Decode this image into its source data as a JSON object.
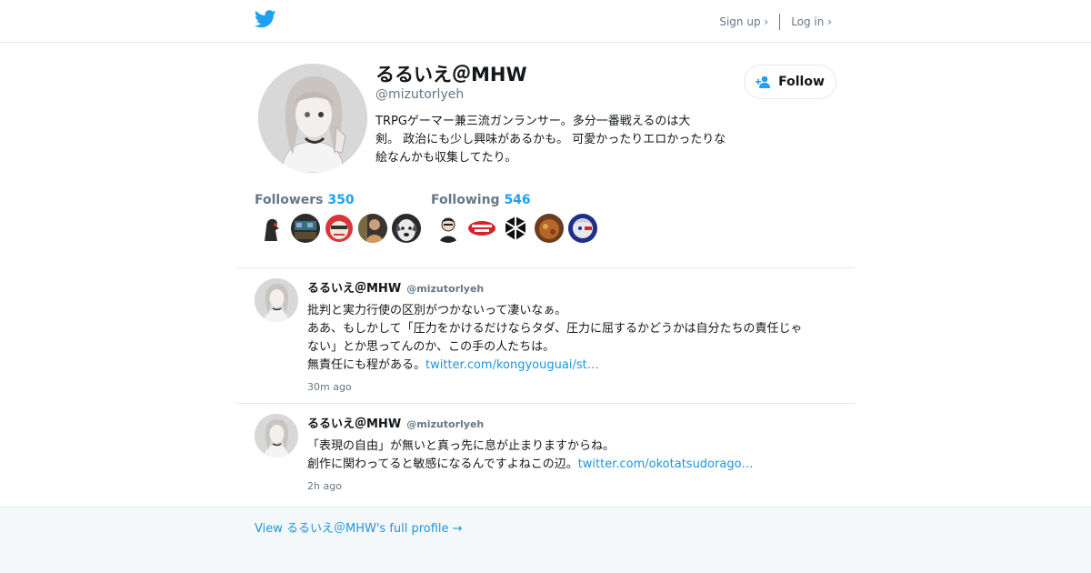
{
  "header": {
    "logo_icon": "twitter-bird-icon",
    "signup_label": "Sign up ›",
    "login_label": "Log in ›",
    "accent": "#1da1f2"
  },
  "profile": {
    "name": "るるいえ＠MHW",
    "handle": "@mizutorlyeh",
    "bio_lines": [
      "TRPGゲーマー兼三流ガンランサー。多分一番戦えるのは大",
      "剣。 政治にも少し興味があるかも。 可愛かったりエロかったりな",
      "絵なんかも収集してたり。"
    ],
    "follow_label": "Follow",
    "follow_icon": "add-user-icon",
    "followers_label": "Followers",
    "followers_count": "350",
    "following_label": "Following",
    "following_count": "546"
  },
  "tweets": [
    {
      "name": "るるいえ＠MHW",
      "handle": "@mizutorlyeh",
      "lines": [
        "批判と実力行使の区別がつかないって凄いなぁ。",
        "ああ、もしかして「圧力をかけるだけならタダ、圧力に屈するかどうかは自分たちの責任じゃ",
        "ない」とか思ってんのか、この手の人たちは。"
      ],
      "last_text": "無責任にも程がある。",
      "link": "twitter.com/kongyouguai/st…",
      "time": "30m ago"
    },
    {
      "name": "るるいえ＠MHW",
      "handle": "@mizutorlyeh",
      "lines": [
        "「表現の自由」が無いと真っ先に息が止まりますからね。"
      ],
      "last_text": "創作に関わってると敏感になるんですよねこの辺。",
      "link": "twitter.com/okotatsudorago…",
      "time": "2h ago"
    }
  ],
  "footer": {
    "view_profile_label": "View るるいえ＠MHW's full profile →"
  }
}
